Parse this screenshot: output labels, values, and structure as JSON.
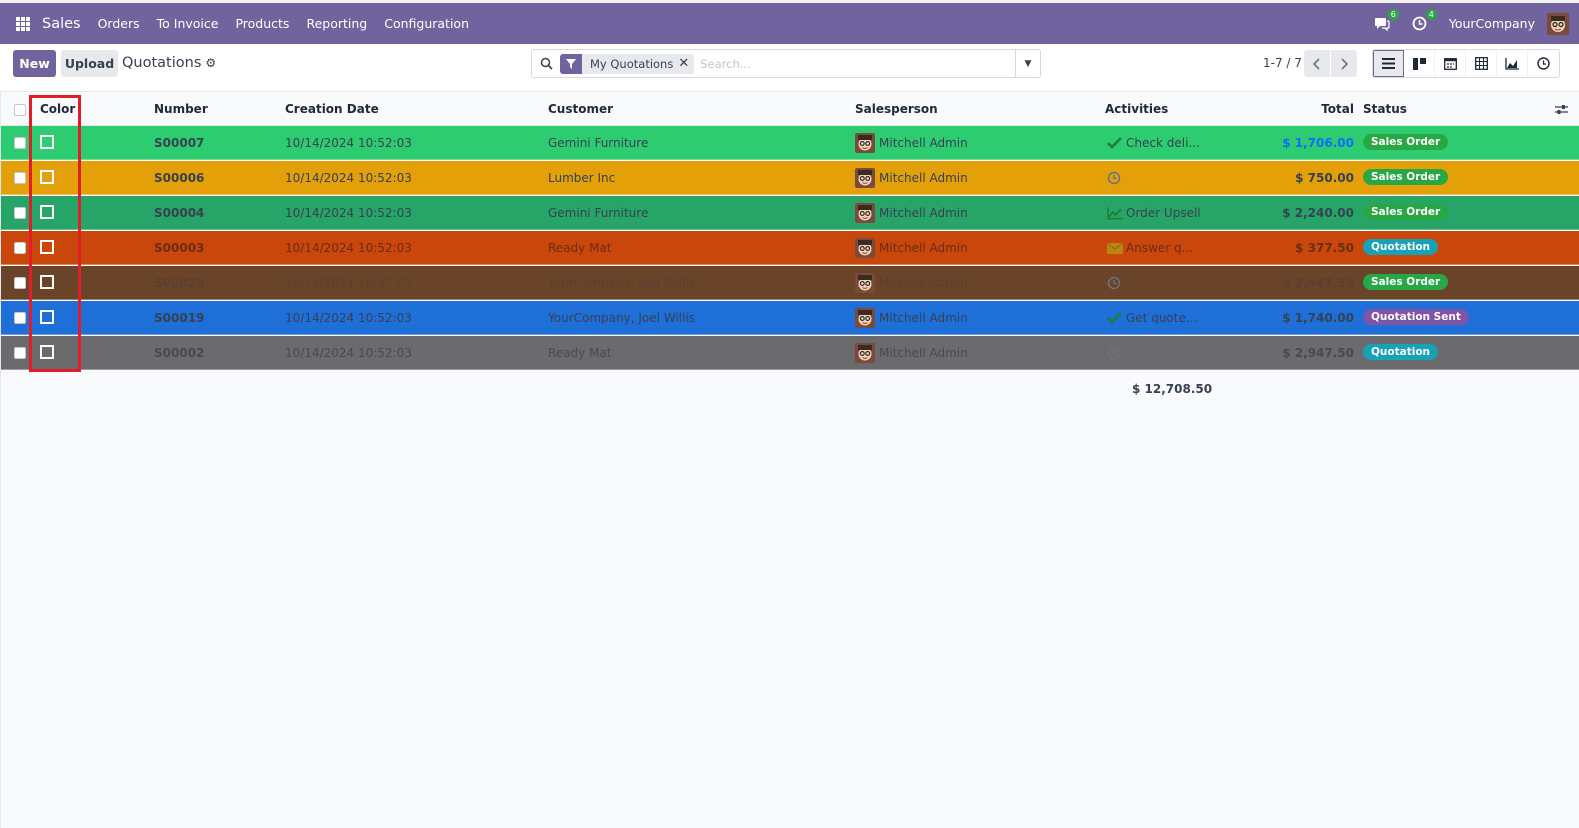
{
  "navbar": {
    "app_name": "Sales",
    "menu": [
      "Orders",
      "To Invoice",
      "Products",
      "Reporting",
      "Configuration"
    ],
    "messages_count": "6",
    "activities_count": "4",
    "company": "YourCompany"
  },
  "control": {
    "new_label": "New",
    "upload_label": "Upload",
    "breadcrumb": "Quotations",
    "facet_label": "My Quotations",
    "search_placeholder": "Search...",
    "pager": "1-7 / 7"
  },
  "columns": {
    "color": "Color",
    "number": "Number",
    "creation_date": "Creation Date",
    "customer": "Customer",
    "salesperson": "Salesperson",
    "activities": "Activities",
    "total": "Total",
    "status": "Status"
  },
  "rows": [
    {
      "color": "#2ecc71",
      "text": "#374151",
      "number": "S00007",
      "date": "10/14/2024 10:52:03",
      "customer": "Gemini Furniture",
      "salesperson": "Mitchell Admin",
      "activity_icon": "check-icon",
      "activity": "Check deli...",
      "total": "$ 1,706.00",
      "status": "Sales Order",
      "status_color": "#28a745"
    },
    {
      "color": "#e3a008",
      "text": "#374151",
      "number": "S00006",
      "date": "10/14/2024 10:52:03",
      "customer": "Lumber Inc",
      "salesperson": "Mitchell Admin",
      "activity_icon": "clock-icon",
      "activity": "",
      "total": "$ 750.00",
      "status": "Sales Order",
      "status_color": "#28a745"
    },
    {
      "color": "#27a569",
      "text": "#374151",
      "number": "S00004",
      "date": "10/14/2024 10:52:03",
      "customer": "Gemini Furniture",
      "salesperson": "Mitchell Admin",
      "activity_icon": "chart-line-icon",
      "activity": "Order Upsell",
      "total": "$ 2,240.00",
      "status": "Sales Order",
      "status_color": "#28a745"
    },
    {
      "color": "#c9470b",
      "text": "#6b2d14",
      "number": "S00003",
      "date": "10/14/2024 10:52:03",
      "customer": "Ready Mat",
      "salesperson": "Mitchell Admin",
      "activity_icon": "envelope-icon",
      "activity": "Answer q...",
      "total": "$ 377.50",
      "status": "Quotation",
      "status_color": "#17a2b8"
    },
    {
      "color": "#6a4428",
      "text": "#5a4030",
      "number": "S00020",
      "date": "10/14/2024 10:52:03",
      "customer": "YourCompany, Joel Willis",
      "salesperson": "Mitchell Admin",
      "activity_icon": "clock-icon",
      "activity": "",
      "total": "$ 2,947.50",
      "status": "Sales Order",
      "status_color": "#28a745"
    },
    {
      "color": "#1f6fd8",
      "text": "#374151",
      "number": "S00019",
      "date": "10/14/2024 10:52:03",
      "customer": "YourCompany, Joel Willis",
      "salesperson": "Mitchell Admin",
      "activity_icon": "check-icon",
      "activity": "Get quote...",
      "total": "$ 1,740.00",
      "status": "Quotation Sent",
      "status_color": "#7e55a8"
    },
    {
      "color": "#6b6b6e",
      "text": "#4a4a4d",
      "number": "S00002",
      "date": "10/14/2024 10:52:03",
      "customer": "Ready Mat",
      "salesperson": "Mitchell Admin",
      "activity_icon": "clock-icon",
      "activity": "",
      "total": "$ 2,947.50",
      "status": "Quotation",
      "status_color": "#17a2b8"
    }
  ],
  "grand_total": "$ 12,708.50",
  "colors": {
    "brand": "#71639e",
    "highlight": "#e11d2a"
  }
}
